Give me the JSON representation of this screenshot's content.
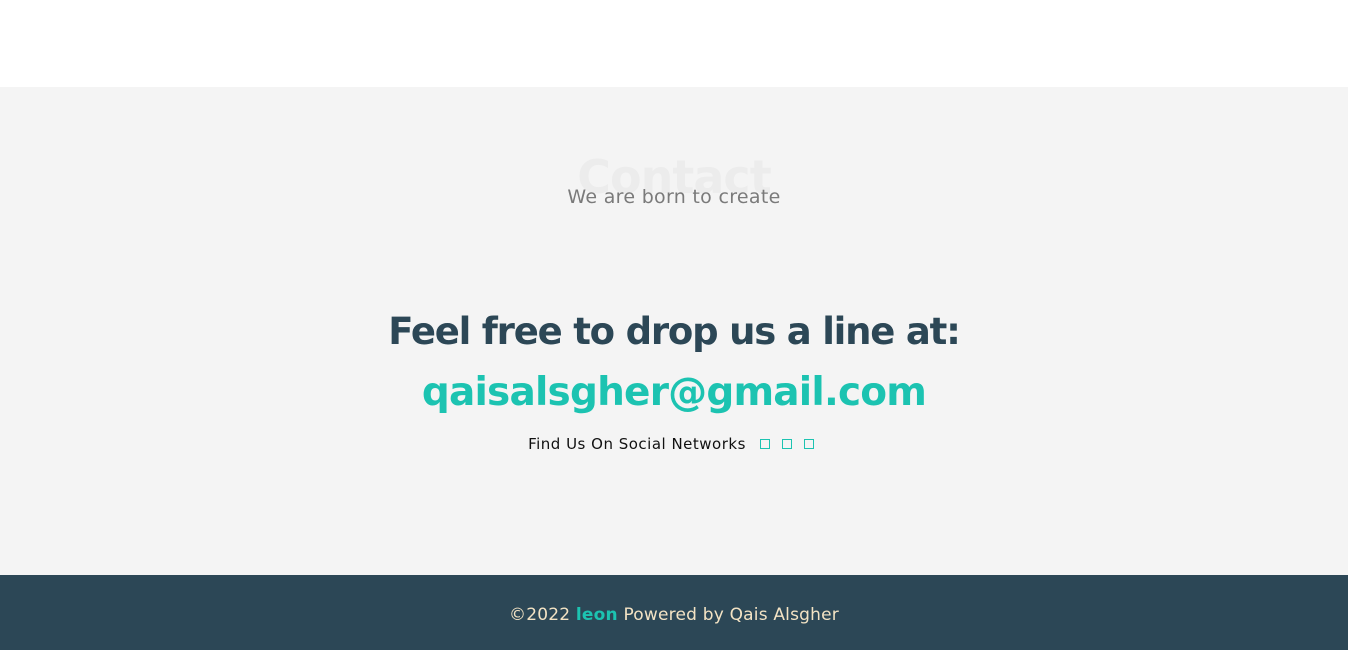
{
  "contact": {
    "background_title": "Contact",
    "subtitle": "We are born to create",
    "heading": "Feel free to drop us a line at:",
    "email": "qaisalsgher@gmail.com",
    "social_label": "Find Us On Social Networks",
    "social_icons": [
      "facebook-icon",
      "twitter-icon",
      "instagram-icon"
    ]
  },
  "footer": {
    "copyright": "©2022",
    "brand": "leon",
    "powered_by": "Powered by Qais Alsgher"
  },
  "colors": {
    "accent": "#1cc3b1",
    "dark": "#2c4756",
    "section_bg": "#f4f4f4",
    "footer_text": "#f3e3c4"
  }
}
